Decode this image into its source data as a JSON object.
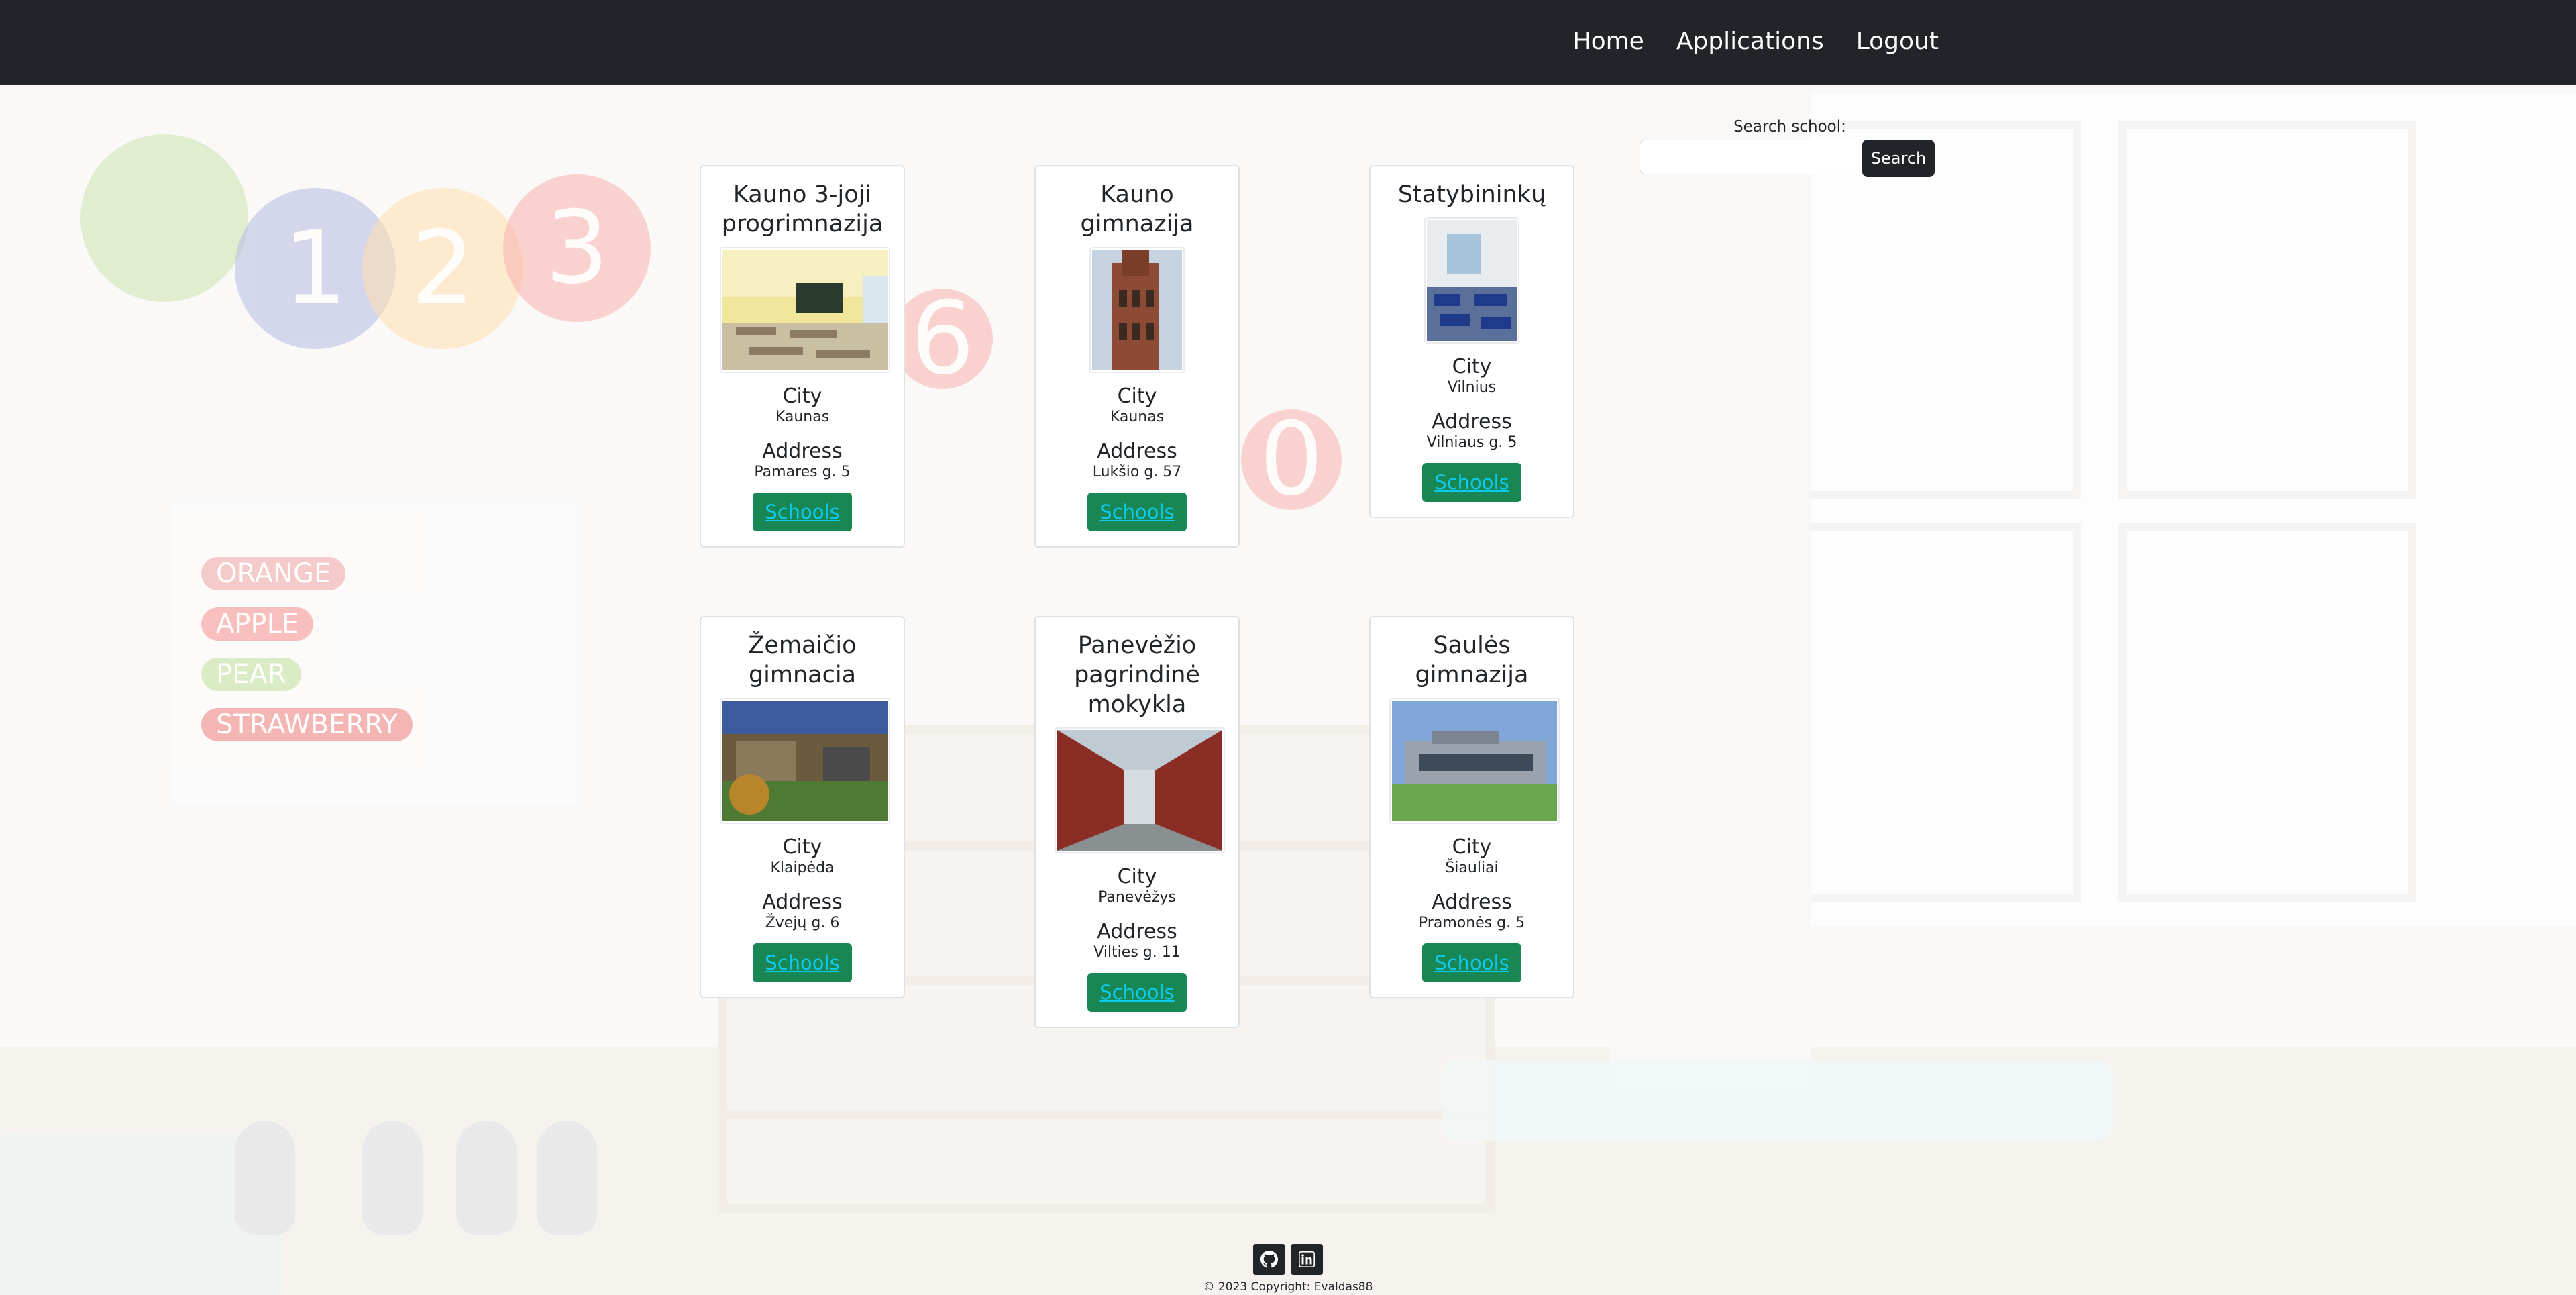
{
  "nav": {
    "links": [
      "Home",
      "Applications",
      "Logout"
    ]
  },
  "search": {
    "label": "Search school:",
    "placeholder": "",
    "button": "Search"
  },
  "labels": {
    "city": "City",
    "address": "Address",
    "schools_button": "Schools"
  },
  "cards": [
    {
      "title": "Kauno 3-joji progrimnazija",
      "city": "Kaunas",
      "address": "Pamares g. 5"
    },
    {
      "title": "Kauno gimnazija",
      "city": "Kaunas",
      "address": "Lukšio g. 57"
    },
    {
      "title": "Statybininkų",
      "city": "Vilnius",
      "address": "Vilniaus g. 5"
    },
    {
      "title": "Žemaičio gimnacia",
      "city": "Klaipėda",
      "address": "Žvejų g. 6"
    },
    {
      "title": "Panevėžio pagrindinė mokykla",
      "city": "Panevėžys",
      "address": "Vilties g. 11"
    },
    {
      "title": "Saulės gimnazija",
      "city": "Šiauliai",
      "address": "Pramonės g. 5"
    }
  ],
  "footer": {
    "icons": [
      "github-icon",
      "linkedin-icon"
    ],
    "copyright": "© 2023 Copyright: Evaldas88"
  },
  "colors": {
    "navbar": "#212529",
    "schools_button": "#198754",
    "schools_button_text": "#0dcaf0"
  }
}
